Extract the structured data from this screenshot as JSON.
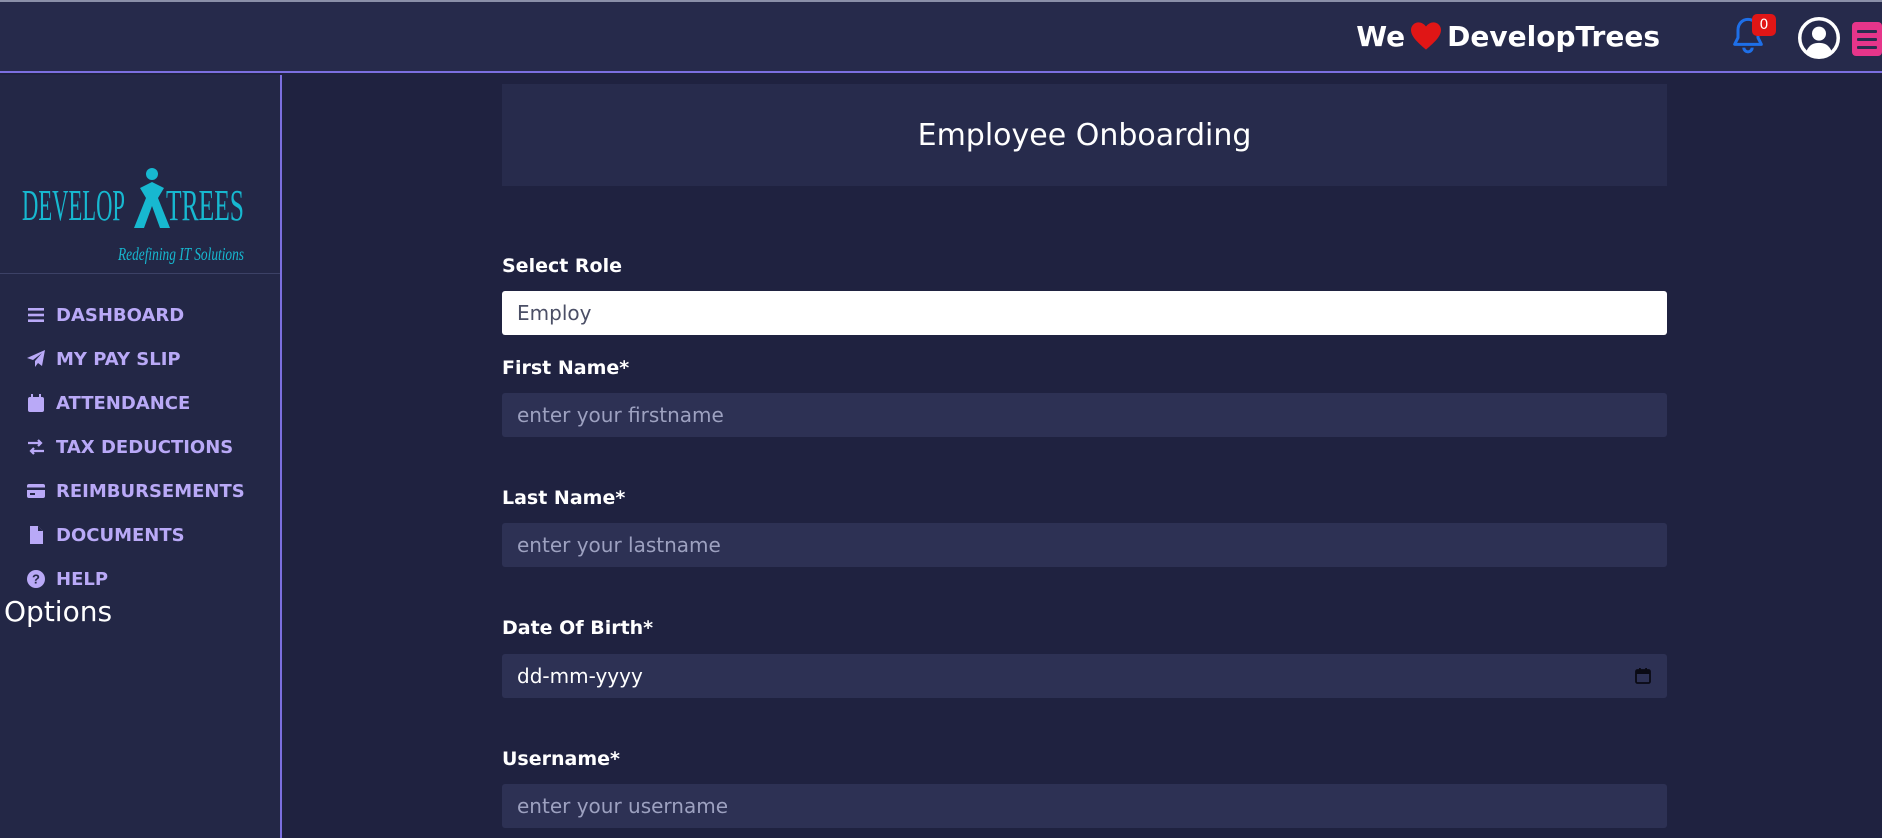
{
  "header": {
    "brand_prefix": "We",
    "brand_name": "DevelopTrees",
    "notification_count": "0",
    "colors": {
      "accent": "#7b6fe0",
      "heart": "#e01616",
      "bell": "#1e6fe8",
      "menu": "#e6358a"
    }
  },
  "sidebar": {
    "logo": {
      "wordmark": "DEVELOP TREES",
      "tagline": "Redefining IT Solutions"
    },
    "items": [
      {
        "label": "DASHBOARD",
        "icon": "bars-icon"
      },
      {
        "label": "MY PAY SLIP",
        "icon": "paper-plane-icon"
      },
      {
        "label": "ATTENDANCE",
        "icon": "calendar-icon"
      },
      {
        "label": "TAX DEDUCTIONS",
        "icon": "exchange-icon"
      },
      {
        "label": "REIMBURSEMENTS",
        "icon": "credit-card-icon"
      },
      {
        "label": "DOCUMENTS",
        "icon": "file-icon"
      },
      {
        "label": "HELP",
        "icon": "question-circle-icon"
      }
    ],
    "options_label": "Options"
  },
  "form": {
    "title": "Employee Onboarding",
    "role": {
      "label": "Select Role",
      "value": "Employ"
    },
    "first_name": {
      "label": "First Name*",
      "placeholder": "enter your firstname"
    },
    "last_name": {
      "label": "Last Name*",
      "placeholder": "enter your lastname"
    },
    "dob": {
      "label": "Date Of Birth*",
      "placeholder": "dd-mm-yyyy"
    },
    "username": {
      "label": "Username*",
      "placeholder": "enter your username"
    }
  }
}
